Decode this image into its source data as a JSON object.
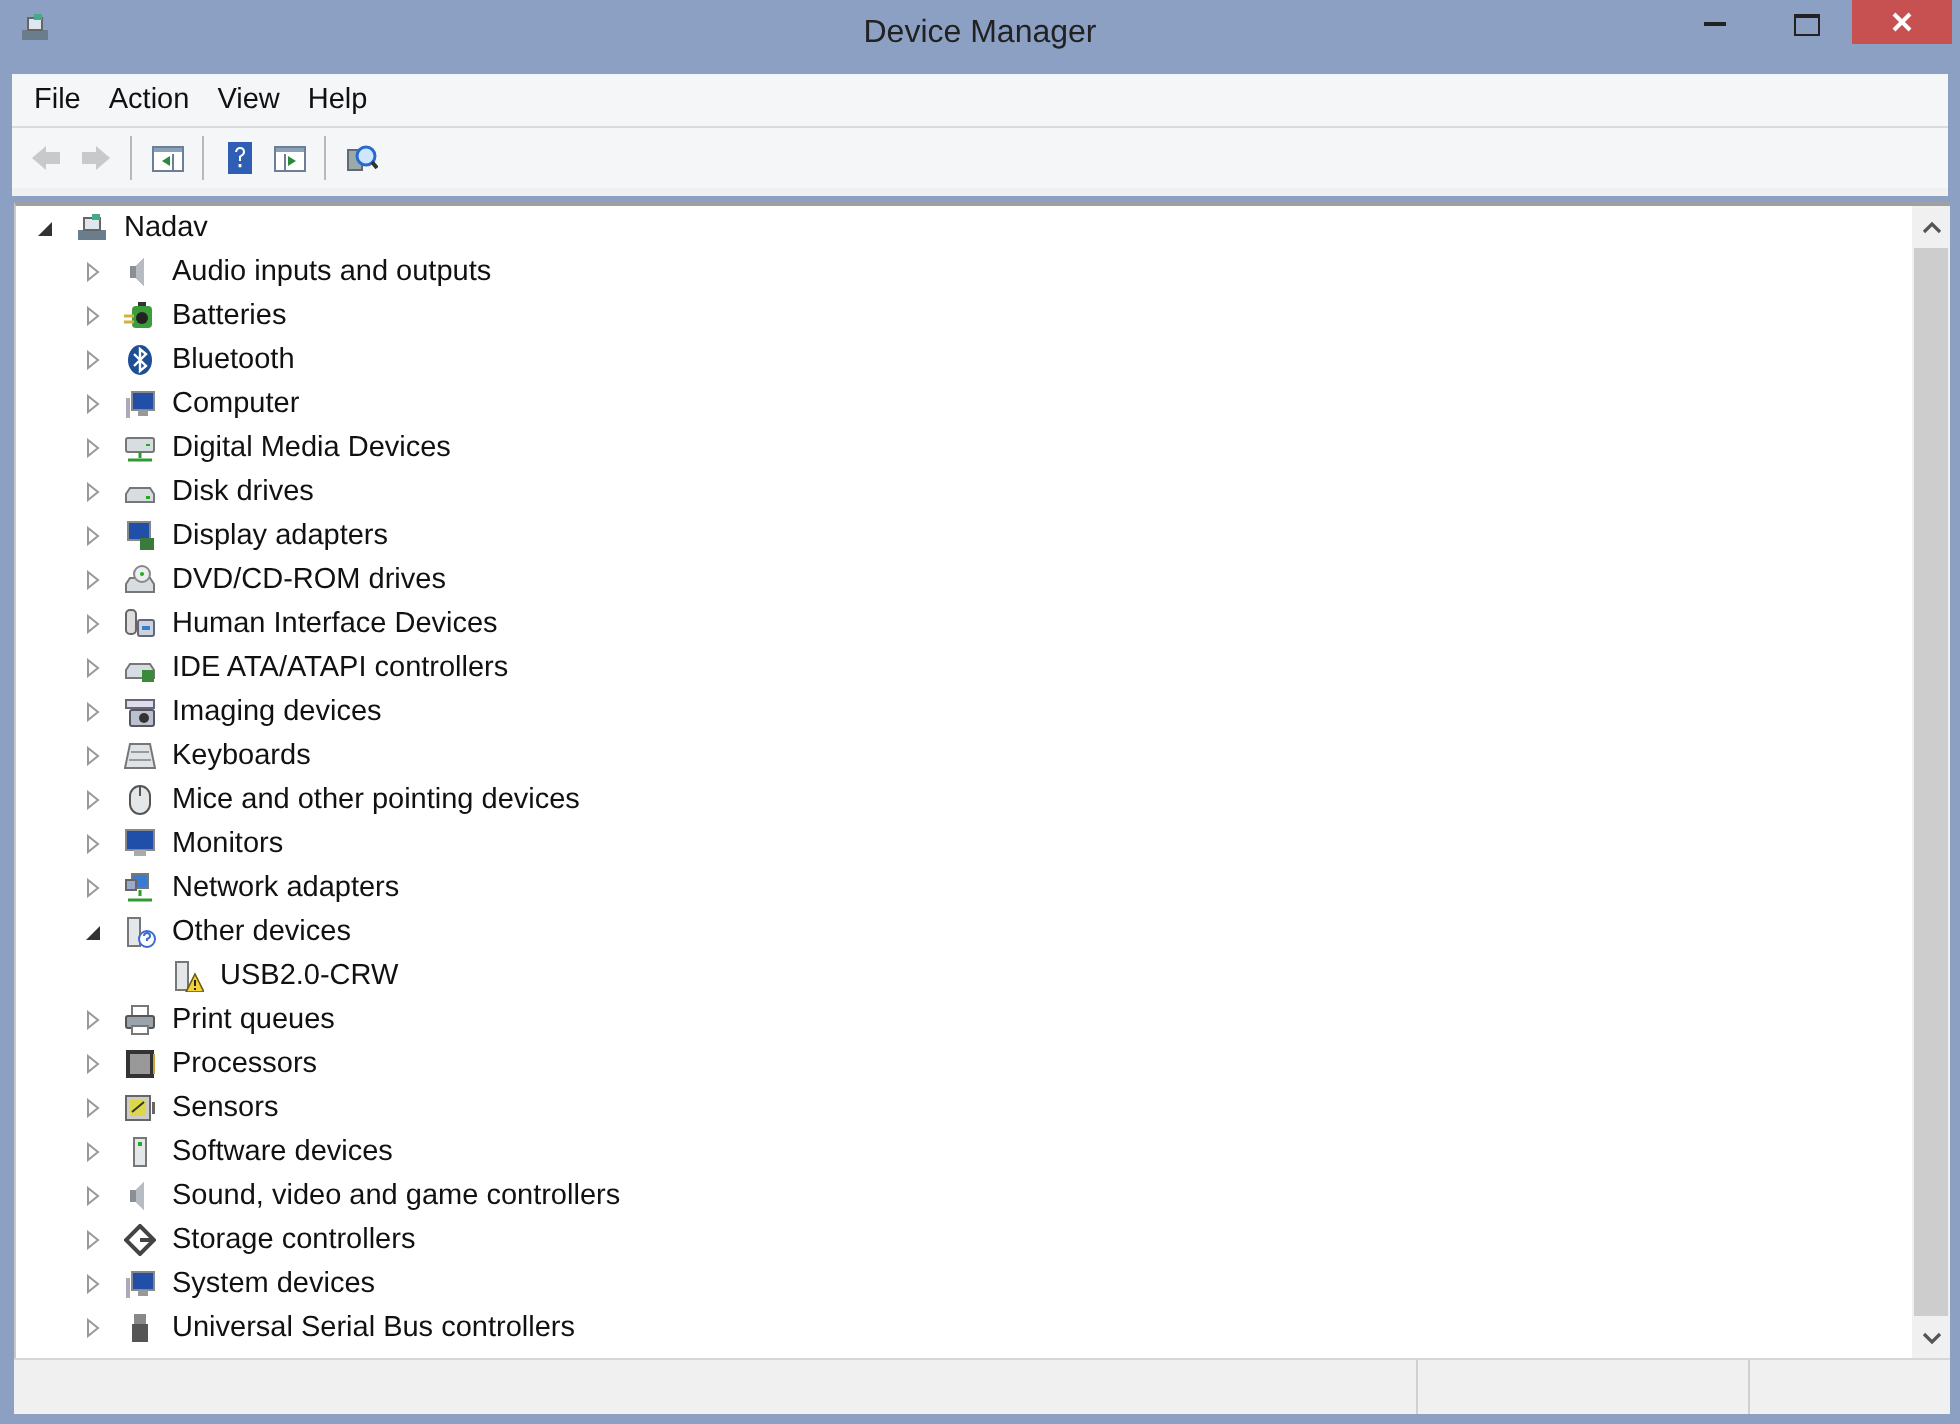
{
  "window": {
    "title": "Device Manager"
  },
  "menu": [
    "File",
    "Action",
    "View",
    "Help"
  ],
  "toolbar": [
    {
      "disabled": true
    },
    {
      "disabled": true
    },
    {
      "disabled": false
    },
    {
      "disabled": false
    },
    {
      "disabled": false
    },
    {
      "disabled": false
    }
  ],
  "tree": {
    "label": "Nadav",
    "expanded": true,
    "children": [
      {
        "label": "Audio inputs and outputs",
        "expanded": false
      },
      {
        "label": "Batteries",
        "expanded": false
      },
      {
        "label": "Bluetooth",
        "expanded": false
      },
      {
        "label": "Computer",
        "expanded": false
      },
      {
        "label": "Digital Media Devices",
        "expanded": false
      },
      {
        "label": "Disk drives",
        "expanded": false
      },
      {
        "label": "Display adapters",
        "expanded": false
      },
      {
        "label": "DVD/CD-ROM drives",
        "expanded": false
      },
      {
        "label": "Human Interface Devices",
        "expanded": false
      },
      {
        "label": "IDE ATA/ATAPI controllers",
        "expanded": false
      },
      {
        "label": "Imaging devices",
        "expanded": false
      },
      {
        "label": "Keyboards",
        "expanded": false
      },
      {
        "label": "Mice and other pointing devices",
        "expanded": false
      },
      {
        "label": "Monitors",
        "expanded": false
      },
      {
        "label": "Network adapters",
        "expanded": false
      },
      {
        "label": "Other devices",
        "expanded": true,
        "children": [
          {
            "label": "USB2.0-CRW",
            "problem": true
          }
        ]
      },
      {
        "label": "Print queues",
        "expanded": false
      },
      {
        "label": "Processors",
        "expanded": false
      },
      {
        "label": "Sensors",
        "expanded": false
      },
      {
        "label": "Software devices",
        "expanded": false
      },
      {
        "label": "Sound, video and game controllers",
        "expanded": false
      },
      {
        "label": "Storage controllers",
        "expanded": false
      },
      {
        "label": "System devices",
        "expanded": false
      },
      {
        "label": "Universal Serial Bus controllers",
        "expanded": false
      }
    ]
  }
}
